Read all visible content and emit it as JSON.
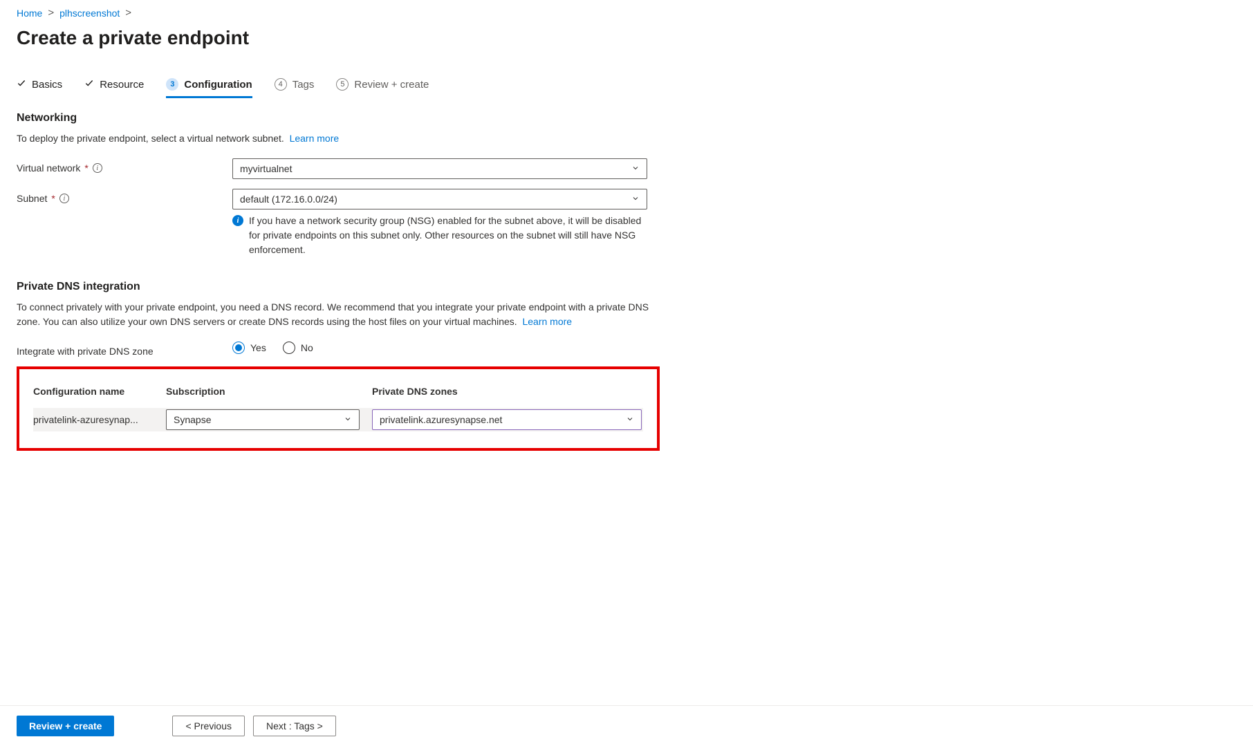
{
  "breadcrumb": {
    "home": "Home",
    "item": "plhscreenshot"
  },
  "page_title": "Create a private endpoint",
  "tabs": {
    "basics": "Basics",
    "resource": "Resource",
    "configuration": "Configuration",
    "tags": "Tags",
    "review": "Review + create",
    "num3": "3",
    "num4": "4",
    "num5": "5"
  },
  "networking": {
    "title": "Networking",
    "desc": "To deploy the private endpoint, select a virtual network subnet.",
    "learn_more": "Learn more",
    "vnet_label": "Virtual network",
    "vnet_value": "myvirtualnet",
    "subnet_label": "Subnet",
    "subnet_value": "default (172.16.0.0/24)",
    "nsg_info": "If you have a network security group (NSG) enabled for the subnet above, it will be disabled for private endpoints on this subnet only. Other resources on the subnet will still have NSG enforcement."
  },
  "dns": {
    "title": "Private DNS integration",
    "desc": "To connect privately with your private endpoint, you need a DNS record. We recommend that you integrate your private endpoint with a private DNS zone. You can also utilize your own DNS servers or create DNS records using the host files on your virtual machines.",
    "learn_more": "Learn more",
    "integrate_label": "Integrate with private DNS zone",
    "yes": "Yes",
    "no": "No",
    "headers": {
      "config": "Configuration name",
      "subscription": "Subscription",
      "zones": "Private DNS zones"
    },
    "row": {
      "config_name": "privatelink-azuresynap...",
      "subscription": "Synapse",
      "zone": "privatelink.azuresynapse.net"
    }
  },
  "footer": {
    "review": "Review + create",
    "previous": "< Previous",
    "next": "Next : Tags >"
  }
}
